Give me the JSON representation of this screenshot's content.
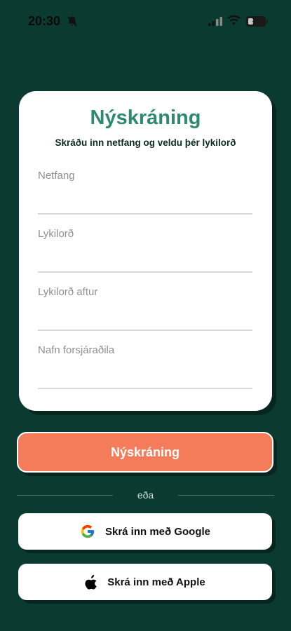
{
  "status_bar": {
    "time": "20:30",
    "battery": "34",
    "icons": [
      "bell-muted-icon",
      "signal-icon",
      "wifi-icon",
      "battery-icon"
    ]
  },
  "card": {
    "title": "Nýskráning",
    "subtitle": "Skráðu inn netfang og veldu þér lykilorð",
    "fields": [
      {
        "label": "Netfang",
        "value": ""
      },
      {
        "label": "Lykilorð",
        "value": ""
      },
      {
        "label": "Lykilorð aftur",
        "value": ""
      },
      {
        "label": "Nafn forsjáraðila",
        "value": ""
      }
    ]
  },
  "actions": {
    "register_label": "Nýskráning",
    "divider_text": "eða",
    "google_label": "Skrá inn með Google",
    "apple_label": "Skrá inn með Apple"
  },
  "colors": {
    "background": "#0b3b30",
    "title": "#2e8a6e",
    "primary_button": "#f47c5a"
  }
}
